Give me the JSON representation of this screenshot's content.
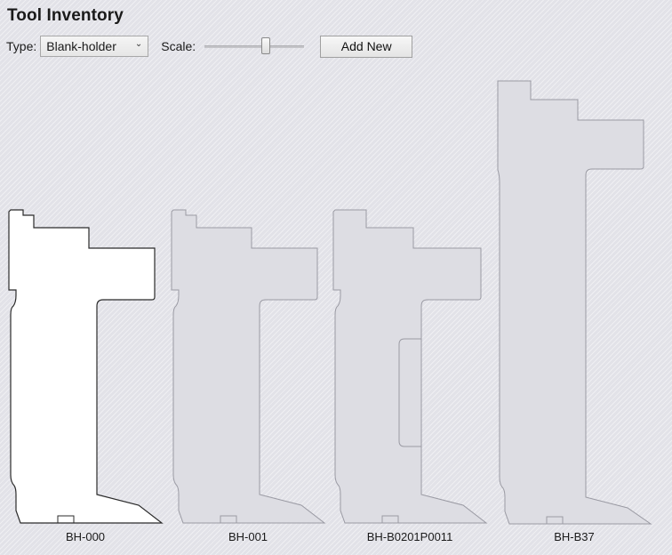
{
  "app": {
    "title": "Tool Inventory"
  },
  "toolbar": {
    "type_label": "Type:",
    "type_selected": "Blank-holder",
    "scale_label": "Scale:",
    "scale_value": 0.63,
    "add_label": "Add New"
  },
  "tools": [
    {
      "name": "BH-000",
      "selected": true
    },
    {
      "name": "BH-001",
      "selected": false
    },
    {
      "name": "BH-B0201P0011",
      "selected": false
    },
    {
      "name": "BH-B37",
      "selected": false
    }
  ],
  "colors": {
    "selected_fill": "#ffffff",
    "selected_stroke": "#2b2b2b",
    "unselected_fill": "#dddde3",
    "unselected_stroke": "#9a9aa3"
  }
}
